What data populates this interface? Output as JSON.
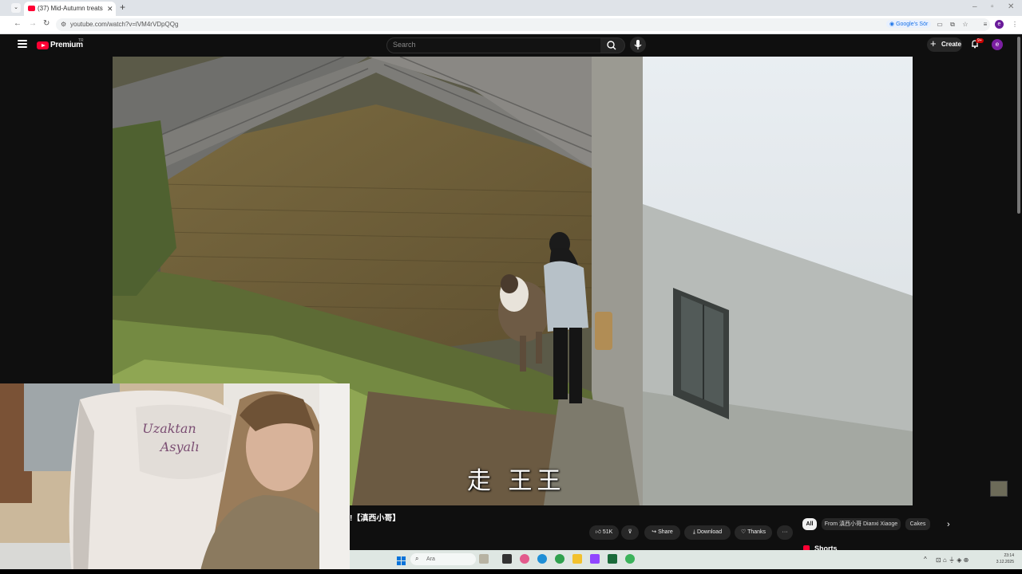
{
  "browser": {
    "tab_title": "(37) Mid-Autumn treats aut...",
    "url": "youtube.com/watch?v=lVM4rVDpQQg",
    "google_search_chip": "Google's Sör",
    "profile_initial": "e"
  },
  "youtube": {
    "brand": "Premium",
    "region": "TR",
    "search_placeholder": "Search",
    "create_label": "Create",
    "notification_count": "9+",
    "avatar_initial": "e"
  },
  "video": {
    "subtitle": "走 王王",
    "title": "!【滇西小哥】"
  },
  "actions": {
    "likes": "51K",
    "share": "Share",
    "download": "Download",
    "thanks": "Thanks",
    "more": "···"
  },
  "chips": [
    "All",
    "From 滇西小哥 Dianxi Xiaoge",
    "Cakes"
  ],
  "shorts_label": "Shorts",
  "webcam": {
    "chair_text_1": "Uzaktan",
    "chair_text_2": "Asyalı"
  },
  "taskbar": {
    "search_text": "Ara",
    "time": "23:14",
    "date": "3.12.2025"
  },
  "colors": {
    "youtube_red": "#ff0033",
    "background": "#0f0f0f",
    "taskbar": "#dfe7e3"
  }
}
